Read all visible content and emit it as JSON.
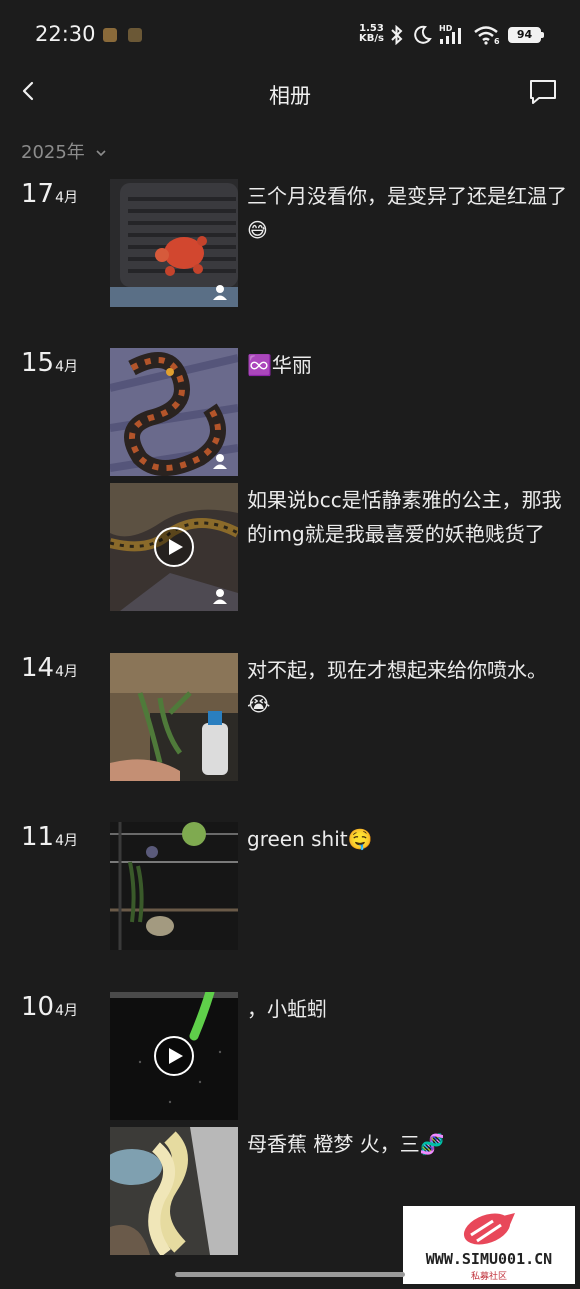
{
  "status_bar": {
    "time": "22:30",
    "net_speed_value": "1.53",
    "net_speed_unit": "KB/s",
    "battery": "94",
    "signal_label": "HD",
    "wifi_label": "6"
  },
  "header": {
    "title": "相册",
    "back_icon": "chevron-left-icon",
    "comment_icon": "message-bubble-icon"
  },
  "year_filter": {
    "value": "2025年"
  },
  "entries": [
    {
      "day": "17",
      "month": "4月",
      "posts": [
        {
          "type": "photo",
          "caption": "三个月没看你，是变异了还是红温了😅",
          "private": true
        }
      ]
    },
    {
      "day": "15",
      "month": "4月",
      "posts": [
        {
          "type": "photo",
          "caption": "♾️华丽",
          "private": true
        },
        {
          "type": "video",
          "caption": "如果说bcc是恬静素雅的公主，那我的img就是我最喜爱的妖艳贱货了",
          "private": true
        }
      ]
    },
    {
      "day": "14",
      "month": "4月",
      "posts": [
        {
          "type": "photo",
          "caption": "对不起，现在才想起来给你喷水。😭",
          "private": false
        }
      ]
    },
    {
      "day": "11",
      "month": "4月",
      "posts": [
        {
          "type": "photo",
          "caption": "green shit🤤",
          "private": false
        }
      ]
    },
    {
      "day": "10",
      "month": "4月",
      "posts": [
        {
          "type": "video",
          "caption": "，小蚯蚓",
          "private": false
        },
        {
          "type": "photo",
          "caption": "母香蕉 橙梦 火，三🧬",
          "private": false
        }
      ]
    }
  ],
  "watermark": {
    "text": "WWW.SIMU001.CN",
    "sub": "私募社区"
  }
}
